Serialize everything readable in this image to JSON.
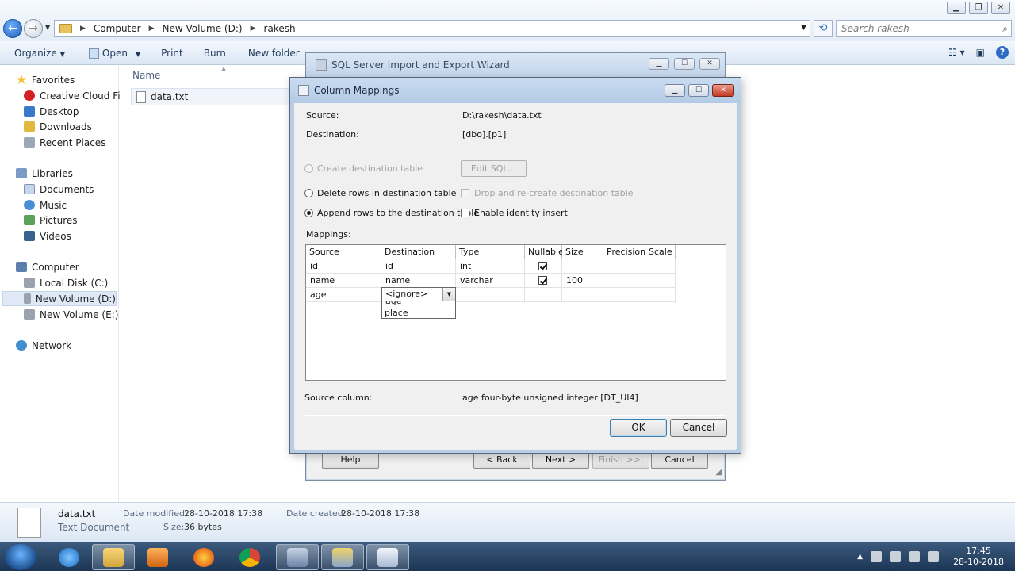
{
  "explorer": {
    "breadcrumb": [
      "Computer",
      "New Volume (D:)",
      "rakesh"
    ],
    "search_placeholder": "Search rakesh",
    "toolbar": {
      "organize": "Organize",
      "open": "Open",
      "print": "Print",
      "burn": "Burn",
      "new_folder": "New folder"
    },
    "nav": {
      "favorites": "Favorites",
      "creative_cloud": "Creative Cloud Files",
      "desktop": "Desktop",
      "downloads": "Downloads",
      "recent": "Recent Places",
      "libraries": "Libraries",
      "documents": "Documents",
      "music": "Music",
      "pictures": "Pictures",
      "videos": "Videos",
      "computer": "Computer",
      "local_disk": "Local Disk (C:)",
      "new_volume_d": "New Volume (D:)",
      "new_volume_e": "New Volume (E:)",
      "network": "Network"
    },
    "column_name": "Name",
    "file_name": "data.txt",
    "details": {
      "name": "data.txt",
      "type": "Text Document",
      "modified_label": "Date modified:",
      "modified_value": "28-10-2018 17:38",
      "size_label": "Size:",
      "size_value": "36 bytes",
      "created_label": "Date created:",
      "created_value": "28-10-2018 17:38"
    }
  },
  "wizard": {
    "title": "SQL Server Import and Export Wizard",
    "help": "Help",
    "back": "< Back",
    "next": "Next >",
    "finish": "Finish >>|",
    "cancel": "Cancel"
  },
  "column_mappings": {
    "title": "Column Mappings",
    "source_label": "Source:",
    "source_value": "D:\\rakesh\\data.txt",
    "destination_label": "Destination:",
    "destination_value": "[dbo].[p1]",
    "create_table": "Create destination table",
    "edit_sql": "Edit SQL...",
    "delete_rows": "Delete rows in destination table",
    "drop_recreate": "Drop and re-create destination table",
    "append_rows": "Append rows to the destination table",
    "identity_insert": "Enable identity insert",
    "mappings_label": "Mappings:",
    "headers": [
      "Source",
      "Destination",
      "Type",
      "Nullable",
      "Size",
      "Precision",
      "Scale"
    ],
    "rows": [
      {
        "source": "id",
        "destination": "id",
        "type": "int",
        "size": ""
      },
      {
        "source": "name",
        "destination": "name",
        "type": "varchar",
        "size": "100"
      },
      {
        "source": "age",
        "destination": "<ignore>",
        "type": "",
        "size": ""
      }
    ],
    "dropdown_cut": "age",
    "dropdown_option": "place",
    "source_column_label": "Source column:",
    "source_column_value": "age  four-byte unsigned integer [DT_UI4]",
    "ok": "OK",
    "cancel": "Cancel"
  },
  "taskbar": {
    "time": "17:45",
    "date": "28-10-2018"
  }
}
